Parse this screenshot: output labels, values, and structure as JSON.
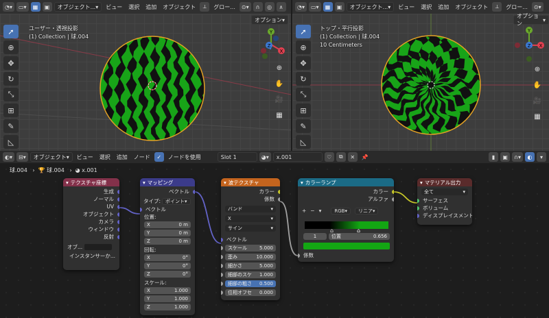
{
  "left_header": {
    "mode": "オブジェクト...",
    "menu": [
      "ビュー",
      "選択",
      "追加",
      "オブジェクト"
    ],
    "orientation": "グロー...",
    "options": "オプション"
  },
  "right_header": {
    "mode": "オブジェクト...",
    "menu": [
      "ビュー",
      "選択",
      "追加",
      "オブジェクト"
    ],
    "orientation": "グロー...",
    "options": "オプション"
  },
  "left_view": {
    "line1": "ユーザー・透視投影",
    "line2": "(1) Collection | 球.004"
  },
  "right_view": {
    "line1": "トップ・平行投影",
    "line2": "(1) Collection | 球.004",
    "line3": "10 Centimeters"
  },
  "gizmo": {
    "x": "X",
    "y": "Y",
    "z": "Z"
  },
  "node_header": {
    "mode": "オブジェクト",
    "menu": [
      "ビュー",
      "選択",
      "追加",
      "ノード"
    ],
    "use_nodes": "ノードを使用",
    "slot": "Slot 1",
    "material": "x.001"
  },
  "breadcrumb": [
    "球.004",
    "球.004",
    "x.001"
  ],
  "nodes": {
    "texcoord": {
      "title": "テクスチャ座標",
      "outputs": [
        "生成",
        "ノーマル",
        "UV",
        "オブジェクト",
        "カメラ",
        "ウィンドウ",
        "反射"
      ],
      "object_label": "オブ...",
      "instancer": "インスタンサーか..."
    },
    "mapping": {
      "title": "マッピング",
      "out": "ベクトル",
      "type_label": "タイプ:",
      "type_value": "ポイント",
      "vector": "ベクトル",
      "loc_label": "位置:",
      "loc": [
        [
          "X",
          "0 m"
        ],
        [
          "Y",
          "0 m"
        ],
        [
          "Z",
          "0 m"
        ]
      ],
      "rot_label": "回転:",
      "rot": [
        [
          "X",
          "0°"
        ],
        [
          "Y",
          "0°"
        ],
        [
          "Z",
          "0°"
        ]
      ],
      "scale_label": "スケール:",
      "scale": [
        [
          "X",
          "1.000"
        ],
        [
          "Y",
          "1.000"
        ],
        [
          "Z",
          "1.000"
        ]
      ]
    },
    "wave": {
      "title": "波テクスチャ",
      "outputs": [
        "カラー",
        "係数"
      ],
      "dropdowns": [
        "バンド",
        "X",
        "サイン"
      ],
      "vector": "ベクトル",
      "fields": [
        [
          "スケール",
          "5.000"
        ],
        [
          "歪み",
          "10.000"
        ],
        [
          "細かさ",
          "5.000"
        ],
        [
          "細部のスケ",
          "1.000"
        ],
        [
          "細部の粗さ",
          "0.500"
        ],
        [
          "位相オフセ",
          "0.000"
        ]
      ]
    },
    "ramp": {
      "title": "カラーランプ",
      "outputs": [
        "カラー",
        "アルファ"
      ],
      "plus": "+",
      "minus": "−",
      "mode": "RGB",
      "interp": "リニア",
      "index": "1",
      "pos_label": "位置",
      "pos_value": "0.656",
      "input": "係数"
    },
    "output": {
      "title": "マテリアル出力",
      "target": "全て",
      "inputs": [
        "サーフェス",
        "ボリューム",
        "ディスプレイスメント"
      ]
    }
  },
  "colors": {
    "header": "#303030",
    "viewport": "#3d3d3d",
    "editor": "#1d1d1d",
    "stripe_green": "#18a418",
    "accent": "#4772b3"
  }
}
